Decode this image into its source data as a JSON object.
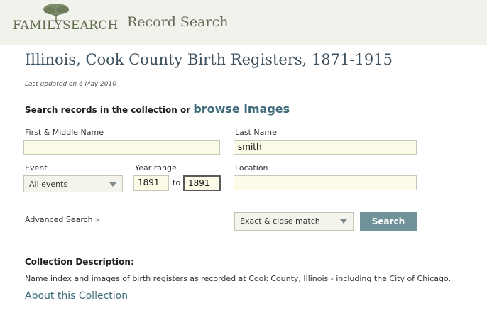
{
  "header": {
    "logo_text": "FAMILYSEARCH",
    "title": "Record Search"
  },
  "collection": {
    "title": "Illinois, Cook County Birth Registers, 1871-1915",
    "updated": "Last updated on 6 May 2010"
  },
  "search": {
    "heading_prefix": "Search records in the collection or",
    "browse_link": "browse images"
  },
  "form": {
    "first_name_label": "First & Middle Name",
    "first_name_value": "",
    "last_name_label": "Last Name",
    "last_name_value": "smith",
    "event_label": "Event",
    "event_value": "All events",
    "year_range_label": "Year range",
    "year_from": "1891",
    "year_to_label": "to",
    "year_to": "1891",
    "location_label": "Location",
    "location_value": "",
    "advanced_link": "Advanced Search »",
    "match_value": "Exact & close match",
    "search_button": "Search"
  },
  "description": {
    "title": "Collection Description:",
    "text": "Name index and images of birth registers as recorded at Cook County, Illinois - including the City of Chicago.",
    "about_link": "About this Collection"
  },
  "colors": {
    "header_bg": "#f2f2ec",
    "input_bg": "#fbfbe8",
    "button_bg": "#6e9298",
    "link": "#3d6a78",
    "title": "#3d5160"
  },
  "icons": [
    "tree-icon",
    "chevron-down-icon"
  ]
}
